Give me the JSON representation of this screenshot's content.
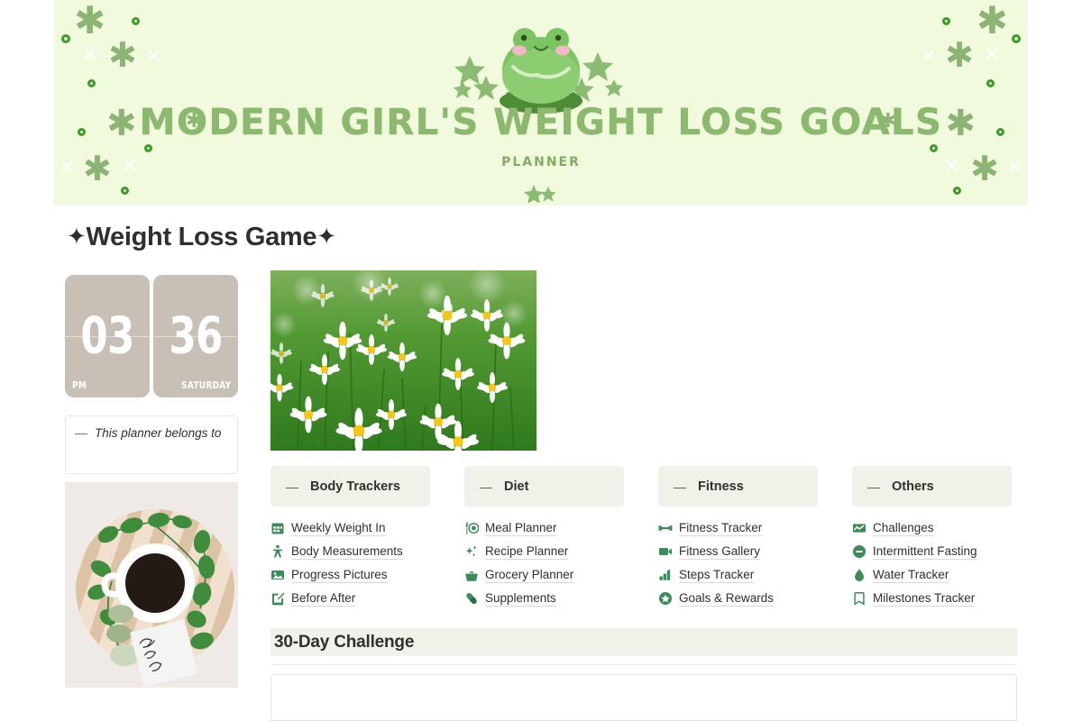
{
  "banner": {
    "title": "MODERN GIRL'S WEIGHT LOSS GOALS",
    "subtitle": "PLANNER",
    "mascot": "frog-mascot",
    "background_color": "#f2fade",
    "title_color": "#8cb96f"
  },
  "page": {
    "title_text": "Weight Loss Game",
    "title_star_left": "✦",
    "title_star_right": "✦"
  },
  "clock": {
    "hour": "03",
    "minute": "36",
    "meridiem": "PM",
    "weekday": "SATURDAY",
    "card_color": "#c8c0b7"
  },
  "callout": {
    "dash": "—",
    "text": "This planner belongs to"
  },
  "photos": {
    "daisy_alt": "daisy-field-photo",
    "coffee_alt": "coffee-flatlay-photo",
    "coffee_note": "enjoy the little things"
  },
  "columns": [
    {
      "dash": "—",
      "title": "Body Trackers",
      "items": [
        {
          "label": "Weekly Weight In",
          "icon": "calendar-icon"
        },
        {
          "label": "Body Measurements",
          "icon": "person-icon"
        },
        {
          "label": "Progress Pictures",
          "icon": "image-icon"
        },
        {
          "label": "Before After",
          "icon": "edit-square-icon"
        }
      ]
    },
    {
      "dash": "—",
      "title": "Diet",
      "items": [
        {
          "label": "Meal Planner",
          "icon": "fork-plate-icon"
        },
        {
          "label": "Recipe Planner",
          "icon": "sparkles-icon"
        },
        {
          "label": "Grocery Planner",
          "icon": "basket-icon"
        },
        {
          "label": "Supplements",
          "icon": "pill-icon"
        }
      ]
    },
    {
      "dash": "—",
      "title": "Fitness",
      "items": [
        {
          "label": "Fitness Tracker",
          "icon": "dumbbell-icon"
        },
        {
          "label": "Fitness Gallery",
          "icon": "video-camera-icon"
        },
        {
          "label": "Steps Tracker",
          "icon": "bar-chart-icon"
        },
        {
          "label": "Goals & Rewards",
          "icon": "star-circle-icon"
        }
      ]
    },
    {
      "dash": "—",
      "title": "Others",
      "items": [
        {
          "label": "Challenges",
          "icon": "trending-chart-icon"
        },
        {
          "label": "Intermittent Fasting",
          "icon": "minus-circle-icon"
        },
        {
          "label": "Water Tracker",
          "icon": "water-drop-icon"
        },
        {
          "label": "Milestones Tracker",
          "icon": "bookmark-icon"
        }
      ]
    }
  ],
  "section": {
    "title": "30-Day Challenge"
  },
  "colors": {
    "icon_green": "#3d8a5a",
    "header_band": "#eef2e9",
    "banner_bg": "#f2fade",
    "text": "#2f2f2c"
  }
}
